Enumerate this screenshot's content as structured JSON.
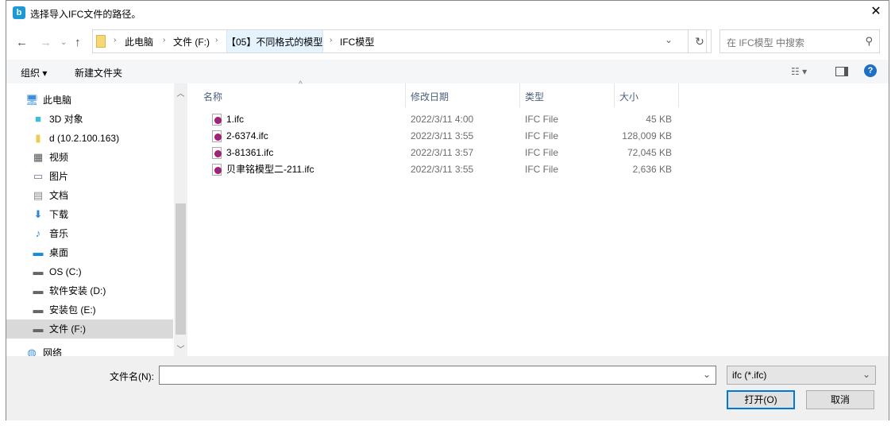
{
  "window": {
    "title": "选择导入IFC文件的路径。",
    "close": "✕",
    "app_icon": "b"
  },
  "address": {
    "breadcrumbs": [
      "此电脑",
      "文件 (F:)",
      "【05】不同格式的模型",
      "IFC模型"
    ],
    "search_placeholder": "在 IFC模型 中搜索"
  },
  "toolbar": {
    "organize": "组织 ▾",
    "new_folder": "新建文件夹"
  },
  "sidebar": {
    "items": [
      {
        "label": "此电脑",
        "icon": "computer-icon"
      },
      {
        "label": "3D 对象",
        "icon": "cube-icon"
      },
      {
        "label": "d (10.2.100.163)",
        "icon": "network-drive-icon"
      },
      {
        "label": "视频",
        "icon": "video-icon"
      },
      {
        "label": "图片",
        "icon": "picture-icon"
      },
      {
        "label": "文档",
        "icon": "document-icon"
      },
      {
        "label": "下载",
        "icon": "download-icon"
      },
      {
        "label": "音乐",
        "icon": "music-icon"
      },
      {
        "label": "桌面",
        "icon": "desktop-icon"
      },
      {
        "label": "OS (C:)",
        "icon": "drive-icon"
      },
      {
        "label": "软件安装 (D:)",
        "icon": "drive-icon"
      },
      {
        "label": "安装包 (E:)",
        "icon": "drive-icon"
      },
      {
        "label": "文件 (F:)",
        "icon": "drive-icon"
      },
      {
        "label": "网络",
        "icon": "network-icon"
      }
    ]
  },
  "columns": [
    "名称",
    "修改日期",
    "类型",
    "大小"
  ],
  "files": [
    {
      "name": "1.ifc",
      "date": "2022/3/11 4:00",
      "type": "IFC File",
      "size": "45 KB"
    },
    {
      "name": "2-6374.ifc",
      "date": "2022/3/11 3:55",
      "type": "IFC File",
      "size": "128,009 KB"
    },
    {
      "name": "3-81361.ifc",
      "date": "2022/3/11 3:57",
      "type": "IFC File",
      "size": "72,045 KB"
    },
    {
      "name": "贝聿铭模型二-211.ifc",
      "date": "2022/3/11 3:55",
      "type": "IFC File",
      "size": "2,636 KB"
    }
  ],
  "footer": {
    "filename_label": "文件名(N):",
    "filename_value": "",
    "filter": "ifc (*.ifc)",
    "open": "打开(O)",
    "cancel": "取消"
  }
}
